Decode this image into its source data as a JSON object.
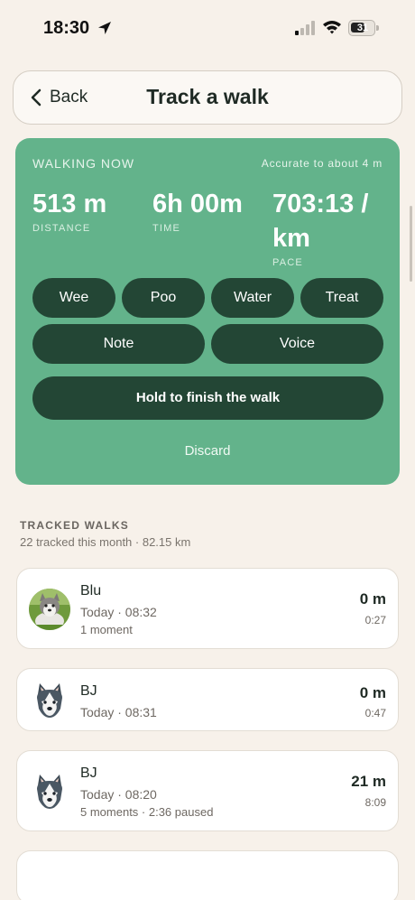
{
  "status_bar": {
    "time": "18:30",
    "battery_level": "31",
    "icons": [
      "location-arrow-icon",
      "signal-icon",
      "wifi-icon",
      "battery-icon"
    ]
  },
  "header": {
    "back_label": "Back",
    "title": "Track a walk"
  },
  "walk_card": {
    "status_label": "WALKING NOW",
    "accuracy": "Accurate to about 4 m",
    "stats": {
      "distance": {
        "value": "513 m",
        "label": "DISTANCE"
      },
      "time": {
        "value": "6h 00m",
        "label": "TIME"
      },
      "pace": {
        "value": "703:13 / km",
        "label": "PACE"
      }
    },
    "actions": {
      "wee": "Wee",
      "poo": "Poo",
      "water": "Water",
      "treat": "Treat",
      "note": "Note",
      "voice": "Voice"
    },
    "finish_label": "Hold to finish the walk",
    "discard_label": "Discard",
    "colors": {
      "card": "#63b38b",
      "button": "#234635"
    }
  },
  "tracked": {
    "title": "TRACKED WALKS",
    "summary": "22 tracked this month · 82.15 km",
    "walks": [
      {
        "dog": "Blu",
        "when": "Today · 08:32",
        "extra": "1 moment",
        "distance": "0 m",
        "duration": "0:27",
        "avatar": "dog-photo"
      },
      {
        "dog": "BJ",
        "when": "Today · 08:31",
        "extra": "",
        "distance": "0 m",
        "duration": "0:47",
        "avatar": "husky-icon"
      },
      {
        "dog": "BJ",
        "when": "Today · 08:20",
        "extra": "5 moments · 2:36 paused",
        "distance": "21 m",
        "duration": "8:09",
        "avatar": "husky-icon"
      }
    ]
  }
}
